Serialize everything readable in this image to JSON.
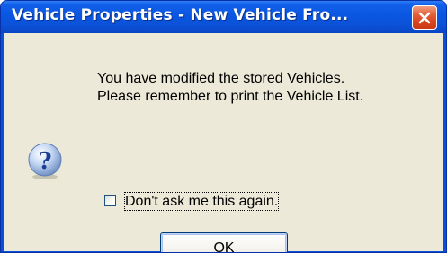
{
  "window": {
    "title": "Vehicle Properties - New Vehicle Fro...",
    "accent_color": "#0b4fd6",
    "close_button_color": "#d8431c"
  },
  "dialog": {
    "message_line1": "You have modified the stored Vehicles.",
    "message_line2": "Please remember to print the Vehicle List.",
    "icon": "question-icon",
    "checkbox": {
      "label": "Don't ask me this again.",
      "checked": false
    },
    "ok_label": "OK"
  }
}
